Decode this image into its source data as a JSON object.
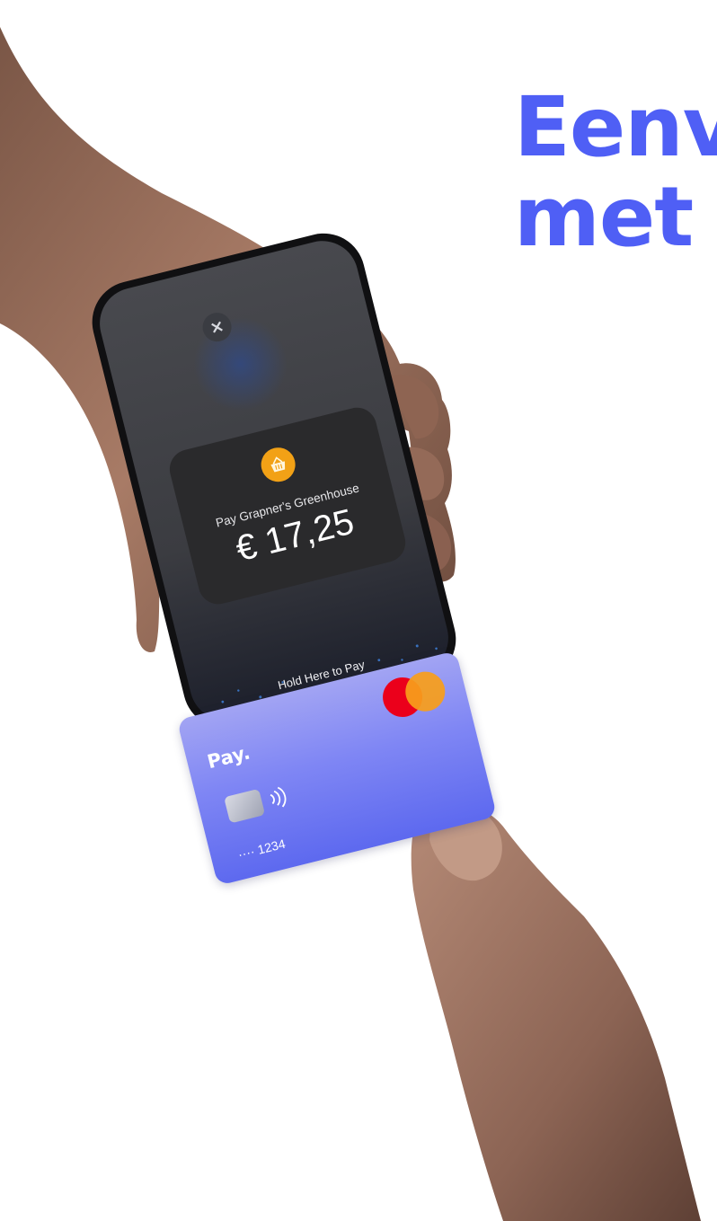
{
  "headline": {
    "line1": "Eenv",
    "line2": "met"
  },
  "phone": {
    "close_symbol": "×",
    "merchant_icon": "basket-icon",
    "pay_label": "Pay Grapner's Greenhouse",
    "amount": "€ 17,25",
    "hold_text": "Hold Here to Pay"
  },
  "card": {
    "brand": "Pay.",
    "network_logo": "mastercard-logo",
    "contactless_icon": "contactless-icon",
    "number": "···· 1234"
  },
  "colors": {
    "headline": "#4f5ff5",
    "card_top": "#a2a4f3",
    "card_bottom": "#5d69ef",
    "badge": "#f2a116",
    "mc_red": "#eb001b",
    "mc_orange": "#f79e1b"
  }
}
